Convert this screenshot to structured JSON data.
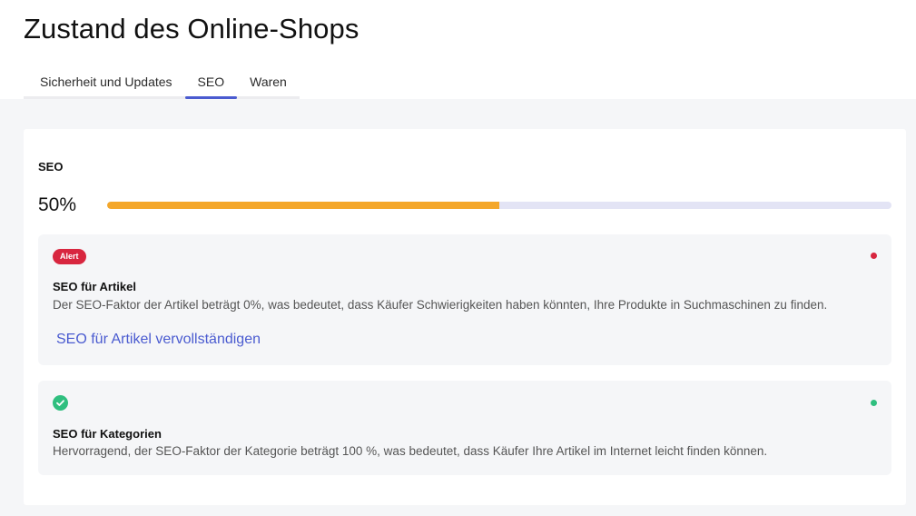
{
  "page": {
    "title": "Zustand des Online-Shops"
  },
  "tabs": [
    {
      "label": "Sicherheit und Updates",
      "active": false
    },
    {
      "label": "SEO",
      "active": true
    },
    {
      "label": "Waren",
      "active": false
    }
  ],
  "seo": {
    "title": "SEO",
    "percent_label": "50%",
    "progress": 0.5,
    "colors": {
      "progress_fill": "#f4a72a",
      "progress_track": "#e3e4f5",
      "accent": "#4a5bd0",
      "alert": "#d8263f",
      "success": "#2fbf7f"
    },
    "items": [
      {
        "status": "alert",
        "badge": "Alert",
        "title": "SEO für Artikel",
        "text": "Der SEO-Faktor der Artikel beträgt 0%, was bedeutet, dass Käufer Schwierigkeiten haben könnten, Ihre Produkte in Suchmaschinen zu finden.",
        "link": "SEO für Artikel vervollständigen",
        "icon": "red-dot-icon"
      },
      {
        "status": "ok",
        "title": "SEO für Kategorien",
        "text": "Hervorragend, der SEO-Faktor der Kategorie beträgt 100 %, was bedeutet, dass Käufer Ihre Artikel im Internet leicht finden können.",
        "icon": "check-circle-icon"
      }
    ]
  }
}
